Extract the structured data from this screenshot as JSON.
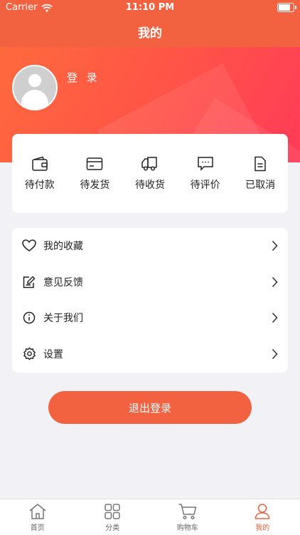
{
  "status_bar": {
    "carrier": "Carrier",
    "time": "11:10 PM",
    "battery_level": 0.9
  },
  "nav": {
    "title": "我的"
  },
  "profile": {
    "login_label": "登 录"
  },
  "orders": [
    {
      "label": "待付款",
      "icon": "wallet-icon"
    },
    {
      "label": "待发货",
      "icon": "card-icon"
    },
    {
      "label": "待收货",
      "icon": "truck-icon"
    },
    {
      "label": "待评价",
      "icon": "comment-icon"
    },
    {
      "label": "已取消",
      "icon": "document-icon"
    }
  ],
  "menu": [
    {
      "label": "我的收藏",
      "icon": "heart-icon"
    },
    {
      "label": "意见反馈",
      "icon": "feedback-icon"
    },
    {
      "label": "关于我们",
      "icon": "info-icon"
    },
    {
      "label": "设置",
      "icon": "gear-icon"
    }
  ],
  "logout_label": "退出登录",
  "tabs": [
    {
      "label": "首页",
      "icon": "home-icon"
    },
    {
      "label": "分类",
      "icon": "grid-icon"
    },
    {
      "label": "购物车",
      "icon": "cart-icon"
    },
    {
      "label": "我的",
      "icon": "user-icon",
      "active": true
    }
  ],
  "colors": {
    "accent": "#f26140",
    "gradient_end": "#ff3b58",
    "background": "#f2f2f6"
  }
}
